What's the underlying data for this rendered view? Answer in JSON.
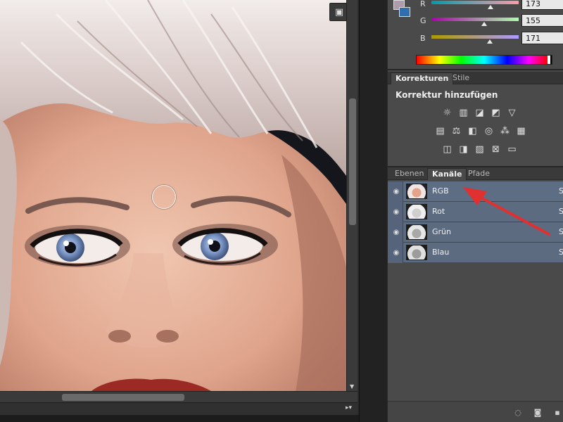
{
  "color_panel": {
    "channels": [
      {
        "label": "R",
        "value": "173",
        "knob_fraction": 0.678
      },
      {
        "label": "G",
        "value": "155",
        "knob_fraction": 0.608
      },
      {
        "label": "B",
        "value": "171",
        "knob_fraction": 0.671
      }
    ],
    "foreground_color": "#ad9bab",
    "background_color": "#2f6fb0"
  },
  "adjustments_panel": {
    "tabs": [
      {
        "label": "Korrekturen",
        "active": true
      },
      {
        "label": "Stile",
        "active": false
      }
    ],
    "heading": "Korrektur hinzufügen",
    "icon_rows": [
      [
        "brightness-icon",
        "levels-icon",
        "curves-icon",
        "exposure-icon",
        "vibrance-icon"
      ],
      [
        "hue-saturation-icon",
        "color-balance-icon",
        "black-white-icon",
        "photo-filter-icon",
        "channel-mixer-icon",
        "color-lookup-icon"
      ],
      [
        "invert-icon",
        "posterize-icon",
        "threshold-icon",
        "selective-color-icon",
        "gradient-map-icon"
      ]
    ]
  },
  "channels_panel": {
    "tabs": [
      {
        "label": "Ebenen",
        "active": false
      },
      {
        "label": "Kanäle",
        "active": true
      },
      {
        "label": "Pfade",
        "active": false
      }
    ],
    "channels": [
      {
        "name": "RGB",
        "shortcut": "S"
      },
      {
        "name": "Rot",
        "shortcut": "S"
      },
      {
        "name": "Grün",
        "shortcut": "S"
      },
      {
        "name": "Blau",
        "shortcut": "S"
      }
    ],
    "footer_icons": [
      "load-selection-icon",
      "save-selection-icon",
      "new-channel-icon"
    ]
  },
  "annotation": {
    "arrow_color": "#e03030"
  }
}
